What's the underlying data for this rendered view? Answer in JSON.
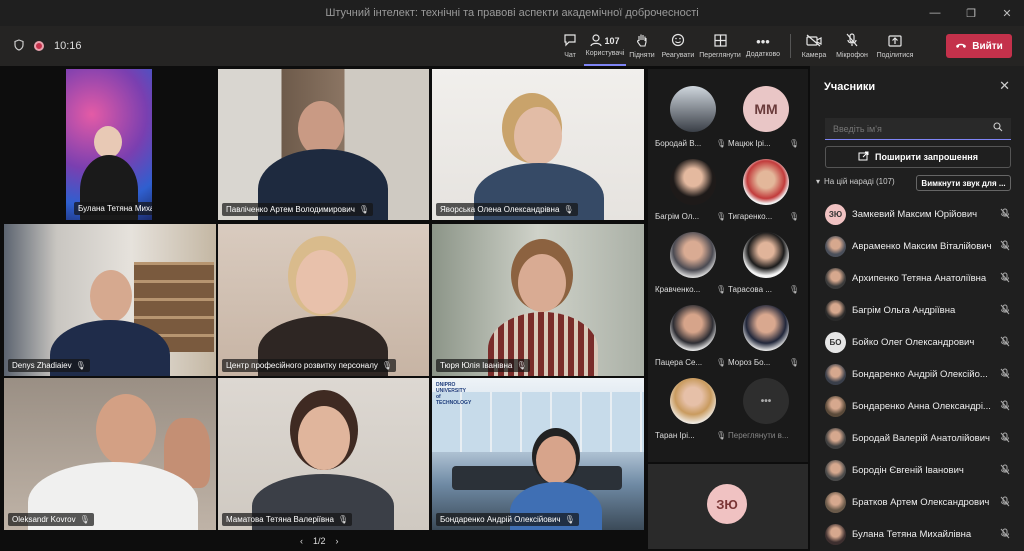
{
  "window": {
    "title": "Штучний інтелект: технічні та правові аспекти академічної доброчесності",
    "controls": [
      "—",
      "❐",
      "✕"
    ]
  },
  "toolbar": {
    "timer": "10:16",
    "chat": {
      "icon": "chat-icon",
      "label": "Чат"
    },
    "people": {
      "icon": "people-icon",
      "label": "Користувачі",
      "count": "107"
    },
    "raise": {
      "icon": "raise-hand-icon",
      "label": "Підняти"
    },
    "react": {
      "icon": "smile-icon",
      "label": "Реагувати"
    },
    "view": {
      "icon": "grid-icon",
      "label": "Переглянути"
    },
    "more": {
      "icon": "more-icon",
      "label": "Додатково"
    },
    "camera": {
      "icon": "camera-icon",
      "label": "Камера"
    },
    "mic": {
      "icon": "mic-off-icon",
      "label": "Мікрофон"
    },
    "share": {
      "icon": "share-icon",
      "label": "Поділитися"
    },
    "leave": {
      "label": "Вийти",
      "color": "#c4314b"
    }
  },
  "stage": {
    "tiles": [
      {
        "name": "Булана Тетяна Михайлівна"
      },
      {
        "name": "Павліченко Артем Володимирович"
      },
      {
        "name": "Яворська Олена Олександрівна"
      },
      {
        "name": "Denys Zhadiaiev"
      },
      {
        "name": "Центр професійного розвитку персоналу"
      },
      {
        "name": "Тюря Юлія Іванівна"
      },
      {
        "name": "Oleksandr Kovrov"
      },
      {
        "name": "Маматова Тетяна Валеріївна"
      },
      {
        "name": "Бондаренко Андрій Олексійович"
      }
    ],
    "background_logo": "DNIPRO UNIVERSITY of TECHNOLOGY",
    "side": [
      {
        "name": "Бородай В...",
        "initials": ""
      },
      {
        "name": "Мацюк Ірі...",
        "initials": "ММ"
      },
      {
        "name": "Багрім Ол...",
        "initials": ""
      },
      {
        "name": "Тигаренко...",
        "initials": ""
      },
      {
        "name": "Кравченко...",
        "initials": ""
      },
      {
        "name": "Тарасова ...",
        "initials": ""
      },
      {
        "name": "Пацера Се...",
        "initials": ""
      },
      {
        "name": "Мороз Бо...",
        "initials": ""
      },
      {
        "name": "Таран Ірі...",
        "initials": ""
      },
      {
        "name": "Переглянути в...",
        "initials": "•••"
      }
    ],
    "self_initials": "ЗЮ",
    "pager": {
      "prev": "‹",
      "text": "1/2",
      "next": "›"
    }
  },
  "panel": {
    "title": "Учасники",
    "search_placeholder": "Введіть ім'я",
    "invite_label": "Поширити запрошення",
    "section_label": "На цій нараді (107)",
    "mute_all_label": "Вимкнути звук для ...",
    "participants": [
      {
        "name": "Замкевий Максим Юрійович",
        "initials": "ЗЮ"
      },
      {
        "name": "Авраменко Максим Віталійович",
        "initials": ""
      },
      {
        "name": "Архипенко Тетяна Анатоліївна",
        "initials": ""
      },
      {
        "name": "Багрім Ольга Андріївна",
        "initials": ""
      },
      {
        "name": "Бойко Олег Олександрович",
        "initials": "БО"
      },
      {
        "name": "Бондаренко Андрій Олексійо...",
        "initials": ""
      },
      {
        "name": "Бондаренко Анна Олександрі...",
        "initials": ""
      },
      {
        "name": "Бородай Валерій Анатолійович",
        "initials": ""
      },
      {
        "name": "Бородін Євгеній Іванович",
        "initials": ""
      },
      {
        "name": "Братков Артем Олександрович",
        "initials": ""
      },
      {
        "name": "Булана Тетяна Михайлівна",
        "initials": ""
      }
    ]
  }
}
